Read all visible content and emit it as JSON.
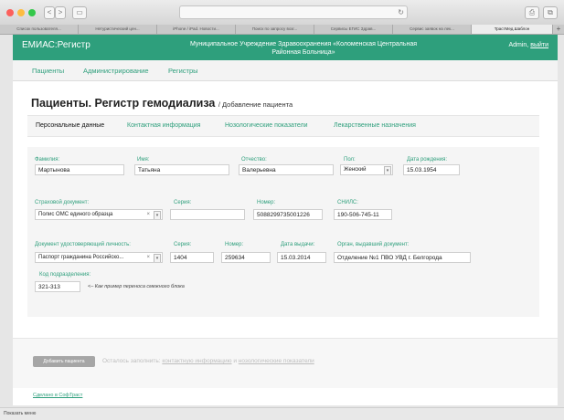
{
  "browser": {
    "back": "<",
    "forward": ">",
    "sidebar": "▭",
    "url_reload": "↻",
    "share": "⎙",
    "tabs_btn": "⧉",
    "new_tab": "+",
    "tabs": [
      {
        "label": "Список пользователя..."
      },
      {
        "label": "Нетуристический цен..."
      },
      {
        "label": "iPhone / iPad. Новости..."
      },
      {
        "label": "Поиск по запросу возг..."
      },
      {
        "label": "Сервисы ЕГИС Здрав..."
      },
      {
        "label": "Сервис заявок на лек..."
      },
      {
        "label": "ТрастМед.Шаблон"
      }
    ]
  },
  "header": {
    "brand": "ЕМИАС:Регистр",
    "org_line1": "Муниципальное Учреждение Здравоохранения «Коломенская Центральная",
    "org_line2": "Районная Больница»",
    "user": "Admin,",
    "logout": "выйти"
  },
  "menu": [
    "Пациенты",
    "Администрирование",
    "Регистры"
  ],
  "page": {
    "title": "Пациенты. Регистр гемодиализа",
    "subtitle": "/ Добавление пациента"
  },
  "subtabs": [
    "Персональные данные",
    "Контактная информация",
    "Нозологические показатели",
    "Лекарственные назначения"
  ],
  "form": {
    "surname": {
      "label": "Фамилия:",
      "value": "Мартынова"
    },
    "name": {
      "label": "Имя:",
      "value": "Татьяна"
    },
    "patronymic": {
      "label": "Отчество:",
      "value": "Валерьевна"
    },
    "sex": {
      "label": "Пол:",
      "value": "Женский"
    },
    "birthdate": {
      "label": "Дата рождения:",
      "value": "15.03.1954"
    },
    "insurance": {
      "label": "Страховой документ:",
      "value": "Полис ОМС единого образца"
    },
    "ins_series": {
      "label": "Серия:",
      "value": ""
    },
    "ins_number": {
      "label": "Номер:",
      "value": "5088299735001226"
    },
    "snils": {
      "label": "СНИЛС:",
      "value": "190-506-745-11"
    },
    "id_doc": {
      "label": "Документ удостоверяющий личность:",
      "value": "Паспорт гражданина Российско..."
    },
    "id_series": {
      "label": "Серия:",
      "value": "1404"
    },
    "id_number": {
      "label": "Номер:",
      "value": "259634"
    },
    "issue_date": {
      "label": "Дата выдачи:",
      "value": "15.03.2014"
    },
    "issued_by": {
      "label": "Орган, выдавший документ:",
      "value": "Отделение №1 ПВО УВД г. Белгорода"
    },
    "dept_code": {
      "label": "Код подразделения:",
      "value": "321-313"
    },
    "dept_note": "<– Как пример переноса смежного блока"
  },
  "actions": {
    "add": "Добавить пациента",
    "hint_pre": "Осталось заполнить:",
    "hint_link1": "контактную информацию",
    "hint_and": "и",
    "hint_link2": "нозологические показатели"
  },
  "footer": {
    "made_by": "Сделано в СофТраст"
  },
  "statusbar": {
    "text": "Показать меню"
  },
  "colors": {
    "accent": "#2e9f7c"
  }
}
